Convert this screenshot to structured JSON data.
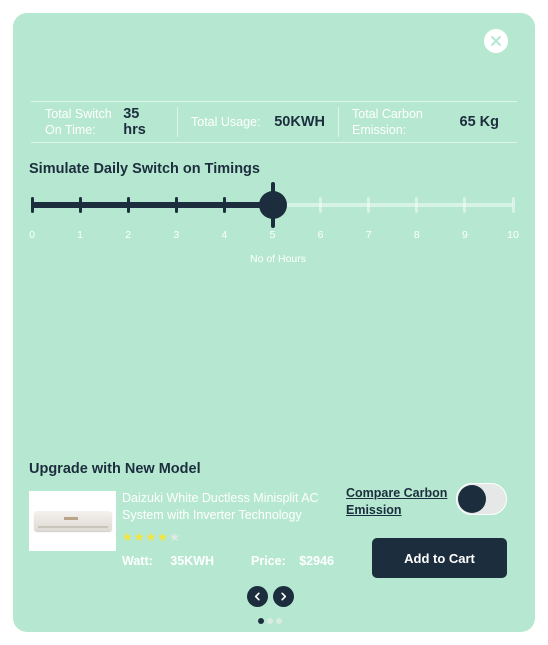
{
  "stats": {
    "switch_label": "Total Switch On Time:",
    "switch_value": "35 hrs",
    "usage_label": "Total Usage:",
    "usage_value": "50KWH",
    "carbon_label": "Total Carbon Emission:",
    "carbon_value": "65 Kg"
  },
  "simulate": {
    "title": "Simulate Daily Switch on Timings",
    "tick_labels": [
      "0",
      "1",
      "2",
      "3",
      "4",
      "5",
      "6",
      "7",
      "8",
      "9",
      "10"
    ],
    "selected_value": 5,
    "max_value": 10,
    "axis_label": "No of Hours"
  },
  "upgrade": {
    "title": "Upgrade with New Model",
    "product_name": "Daizuki White Ductless Minisplit AC System with Inverter Technology",
    "rating": 4,
    "rating_max": 5,
    "watt_label": "Watt:",
    "watt_value": "35KWH",
    "price_label": "Price:",
    "price_value": "$2946",
    "compare_label": "Compare Carbon Emission",
    "compare_enabled": false,
    "add_to_cart_label": "Add to Cart",
    "pagination": {
      "total": 3,
      "active": 1
    }
  },
  "colors": {
    "modal_bg": "#b6e8d1",
    "primary": "#1c2e3d",
    "star": "#f5e33a"
  },
  "icons": {
    "close": "close-icon",
    "prev": "chevron-left-icon",
    "next": "chevron-right-icon",
    "star": "star-icon"
  }
}
